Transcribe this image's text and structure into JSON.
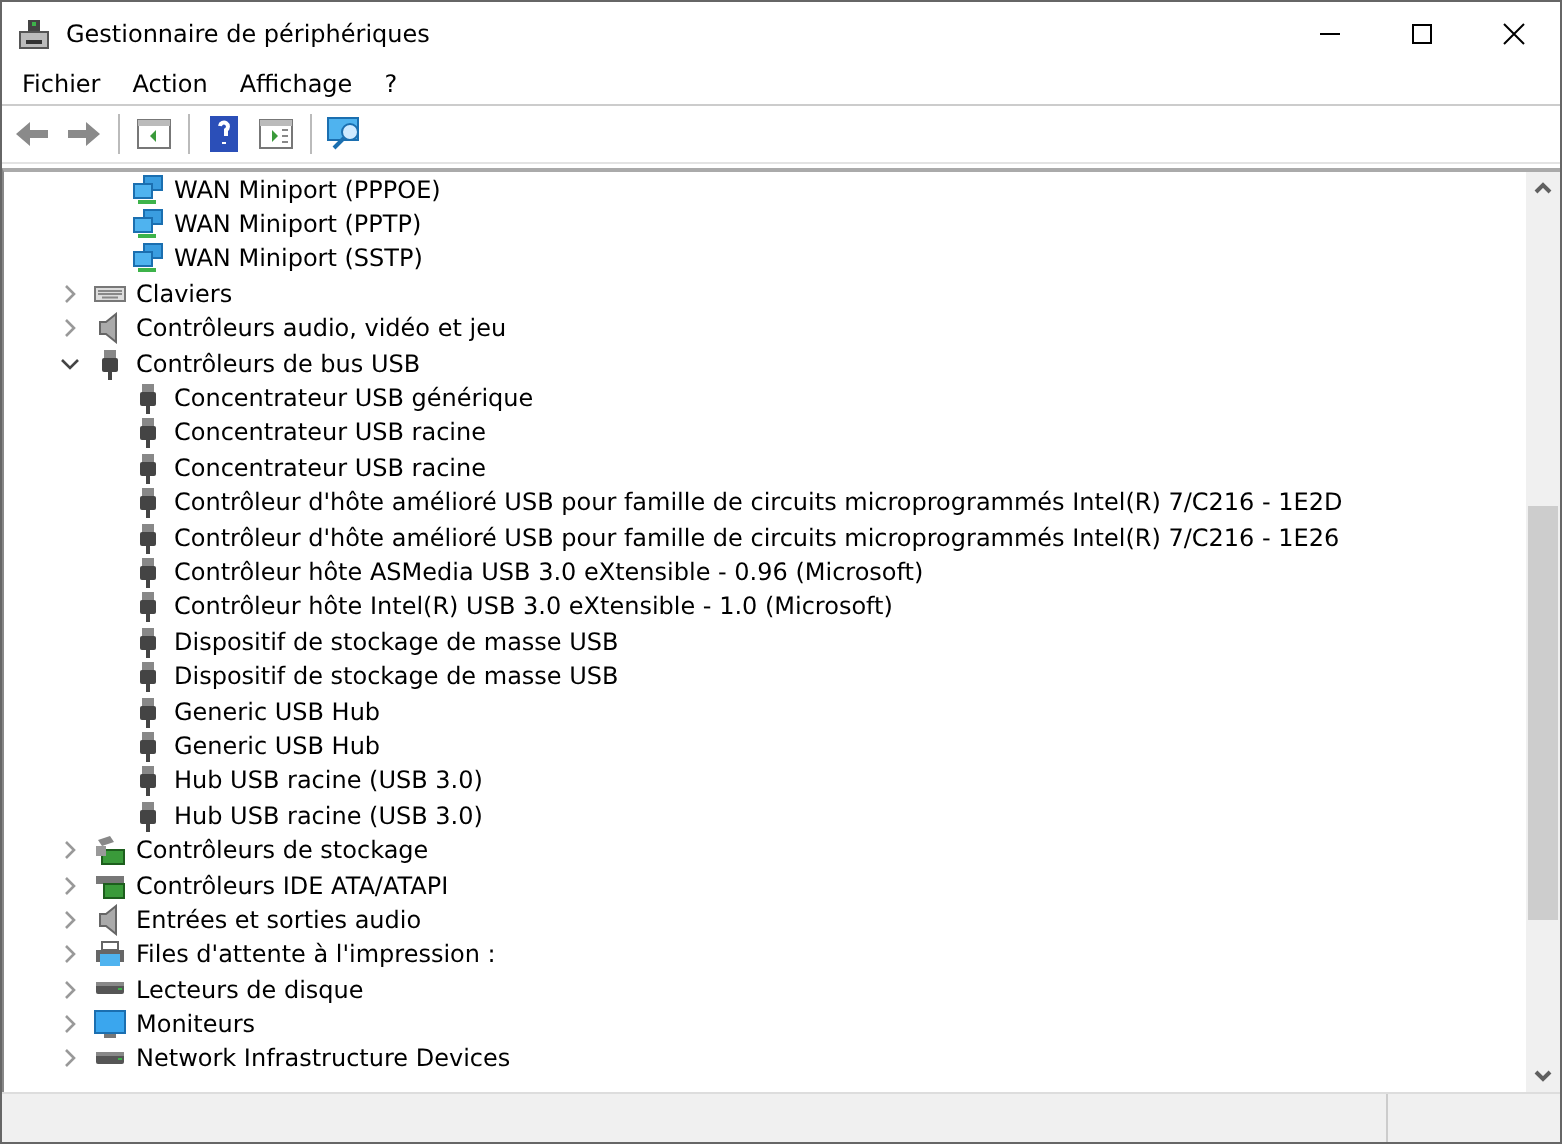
{
  "window": {
    "title": "Gestionnaire de périphériques"
  },
  "menu": [
    {
      "label": "Fichier"
    },
    {
      "label": "Action"
    },
    {
      "label": "Affichage"
    },
    {
      "label": "?"
    }
  ],
  "toolbar": [
    {
      "kind": "back",
      "disabled": true
    },
    {
      "kind": "forward",
      "disabled": true
    },
    {
      "kind": "sep"
    },
    {
      "kind": "panel"
    },
    {
      "kind": "sep"
    },
    {
      "kind": "help"
    },
    {
      "kind": "panel2"
    },
    {
      "kind": "sep"
    },
    {
      "kind": "scan"
    }
  ],
  "tree": {
    "partial_children": [
      {
        "label": "WAN Miniport (PPPOE)",
        "kind": "network"
      },
      {
        "label": "WAN Miniport (PPTP)",
        "kind": "network"
      },
      {
        "label": "WAN Miniport (SSTP)",
        "kind": "network"
      }
    ],
    "items": [
      {
        "label": "Claviers",
        "kind": "keyboard",
        "expanded": false
      },
      {
        "label": "Contrôleurs audio, vidéo et jeu",
        "kind": "audio",
        "expanded": false
      },
      {
        "label": "Contrôleurs de bus USB",
        "kind": "usb",
        "expanded": true,
        "children": [
          {
            "label": "Concentrateur USB générique",
            "kind": "usb"
          },
          {
            "label": "Concentrateur USB racine",
            "kind": "usb"
          },
          {
            "label": "Concentrateur USB racine",
            "kind": "usb"
          },
          {
            "label": "Contrôleur d'hôte amélioré USB pour famille de circuits microprogrammés Intel(R) 7/C216 - 1E2D",
            "kind": "usb"
          },
          {
            "label": "Contrôleur d'hôte amélioré USB pour famille de circuits microprogrammés Intel(R) 7/C216 - 1E26",
            "kind": "usb"
          },
          {
            "label": "Contrôleur hôte ASMedia USB 3.0 eXtensible - 0.96 (Microsoft)",
            "kind": "usb"
          },
          {
            "label": "Contrôleur hôte Intel(R) USB 3.0 eXtensible - 1.0 (Microsoft)",
            "kind": "usb"
          },
          {
            "label": "Dispositif de stockage de masse USB",
            "kind": "usb"
          },
          {
            "label": "Dispositif de stockage de masse USB",
            "kind": "usb"
          },
          {
            "label": "Generic USB Hub",
            "kind": "usb"
          },
          {
            "label": "Generic USB Hub",
            "kind": "usb"
          },
          {
            "label": "Hub USB racine (USB 3.0)",
            "kind": "usb"
          },
          {
            "label": "Hub USB racine (USB 3.0)",
            "kind": "usb"
          }
        ]
      },
      {
        "label": "Contrôleurs de stockage",
        "kind": "storage",
        "expanded": false
      },
      {
        "label": "Contrôleurs IDE ATA/ATAPI",
        "kind": "ide",
        "expanded": false
      },
      {
        "label": "Entrées et sorties audio",
        "kind": "audio",
        "expanded": false
      },
      {
        "label": "Files d'attente à l'impression :",
        "kind": "printer",
        "expanded": false
      },
      {
        "label": "Lecteurs de disque",
        "kind": "disk",
        "expanded": false
      },
      {
        "label": "Moniteurs",
        "kind": "monitor",
        "expanded": false
      },
      {
        "label": "Network Infrastructure Devices",
        "kind": "disk",
        "expanded": false
      }
    ]
  }
}
